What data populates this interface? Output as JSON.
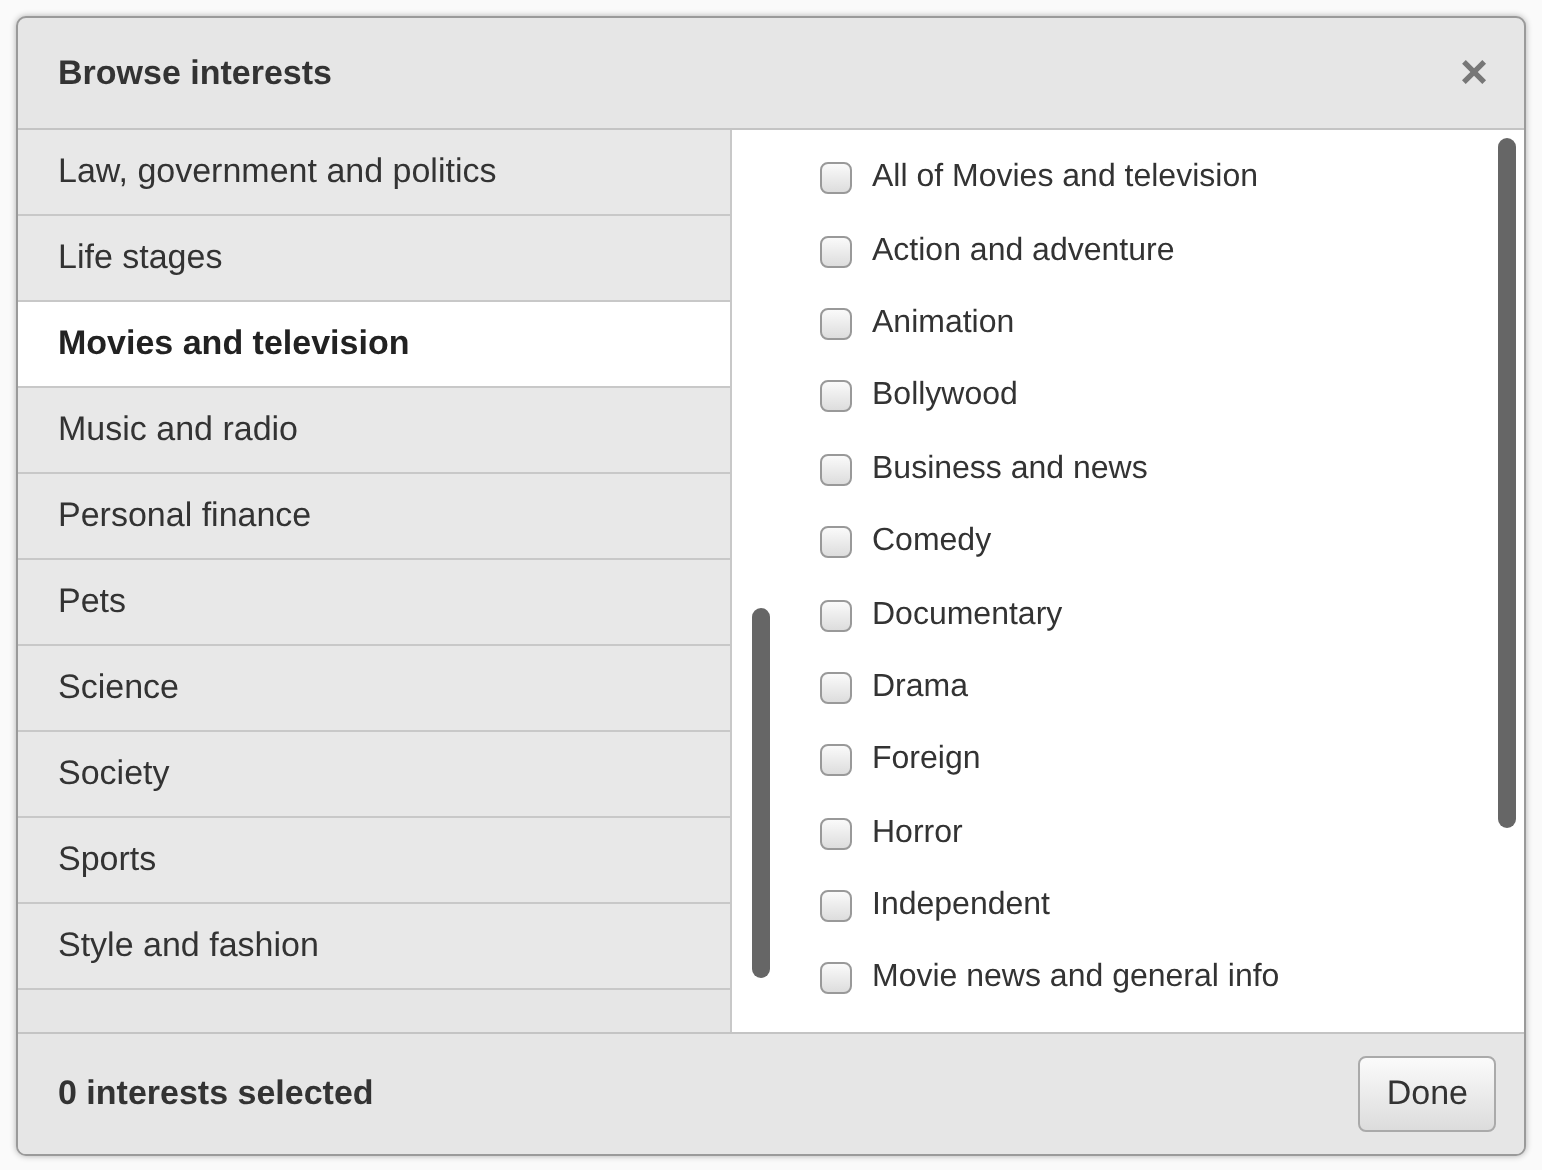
{
  "dialog": {
    "title": "Browse interests",
    "close": "×"
  },
  "categories": [
    {
      "label": "Law, government and politics",
      "selected": false
    },
    {
      "label": "Life stages",
      "selected": false
    },
    {
      "label": "Movies and television",
      "selected": true
    },
    {
      "label": "Music and radio",
      "selected": false
    },
    {
      "label": "Personal finance",
      "selected": false
    },
    {
      "label": "Pets",
      "selected": false
    },
    {
      "label": "Science",
      "selected": false
    },
    {
      "label": "Society",
      "selected": false
    },
    {
      "label": "Sports",
      "selected": false
    },
    {
      "label": "Style and fashion",
      "selected": false
    }
  ],
  "options": [
    {
      "label": "All of Movies and television",
      "checked": false
    },
    {
      "label": "Action and adventure",
      "checked": false
    },
    {
      "label": "Animation",
      "checked": false
    },
    {
      "label": "Bollywood",
      "checked": false
    },
    {
      "label": "Business and news",
      "checked": false
    },
    {
      "label": "Comedy",
      "checked": false
    },
    {
      "label": "Documentary",
      "checked": false
    },
    {
      "label": "Drama",
      "checked": false
    },
    {
      "label": "Foreign",
      "checked": false
    },
    {
      "label": "Horror",
      "checked": false
    },
    {
      "label": "Independent",
      "checked": false
    },
    {
      "label": "Movie news and general info",
      "checked": false
    }
  ],
  "footer": {
    "status": "0 interests selected",
    "button": "Done"
  }
}
